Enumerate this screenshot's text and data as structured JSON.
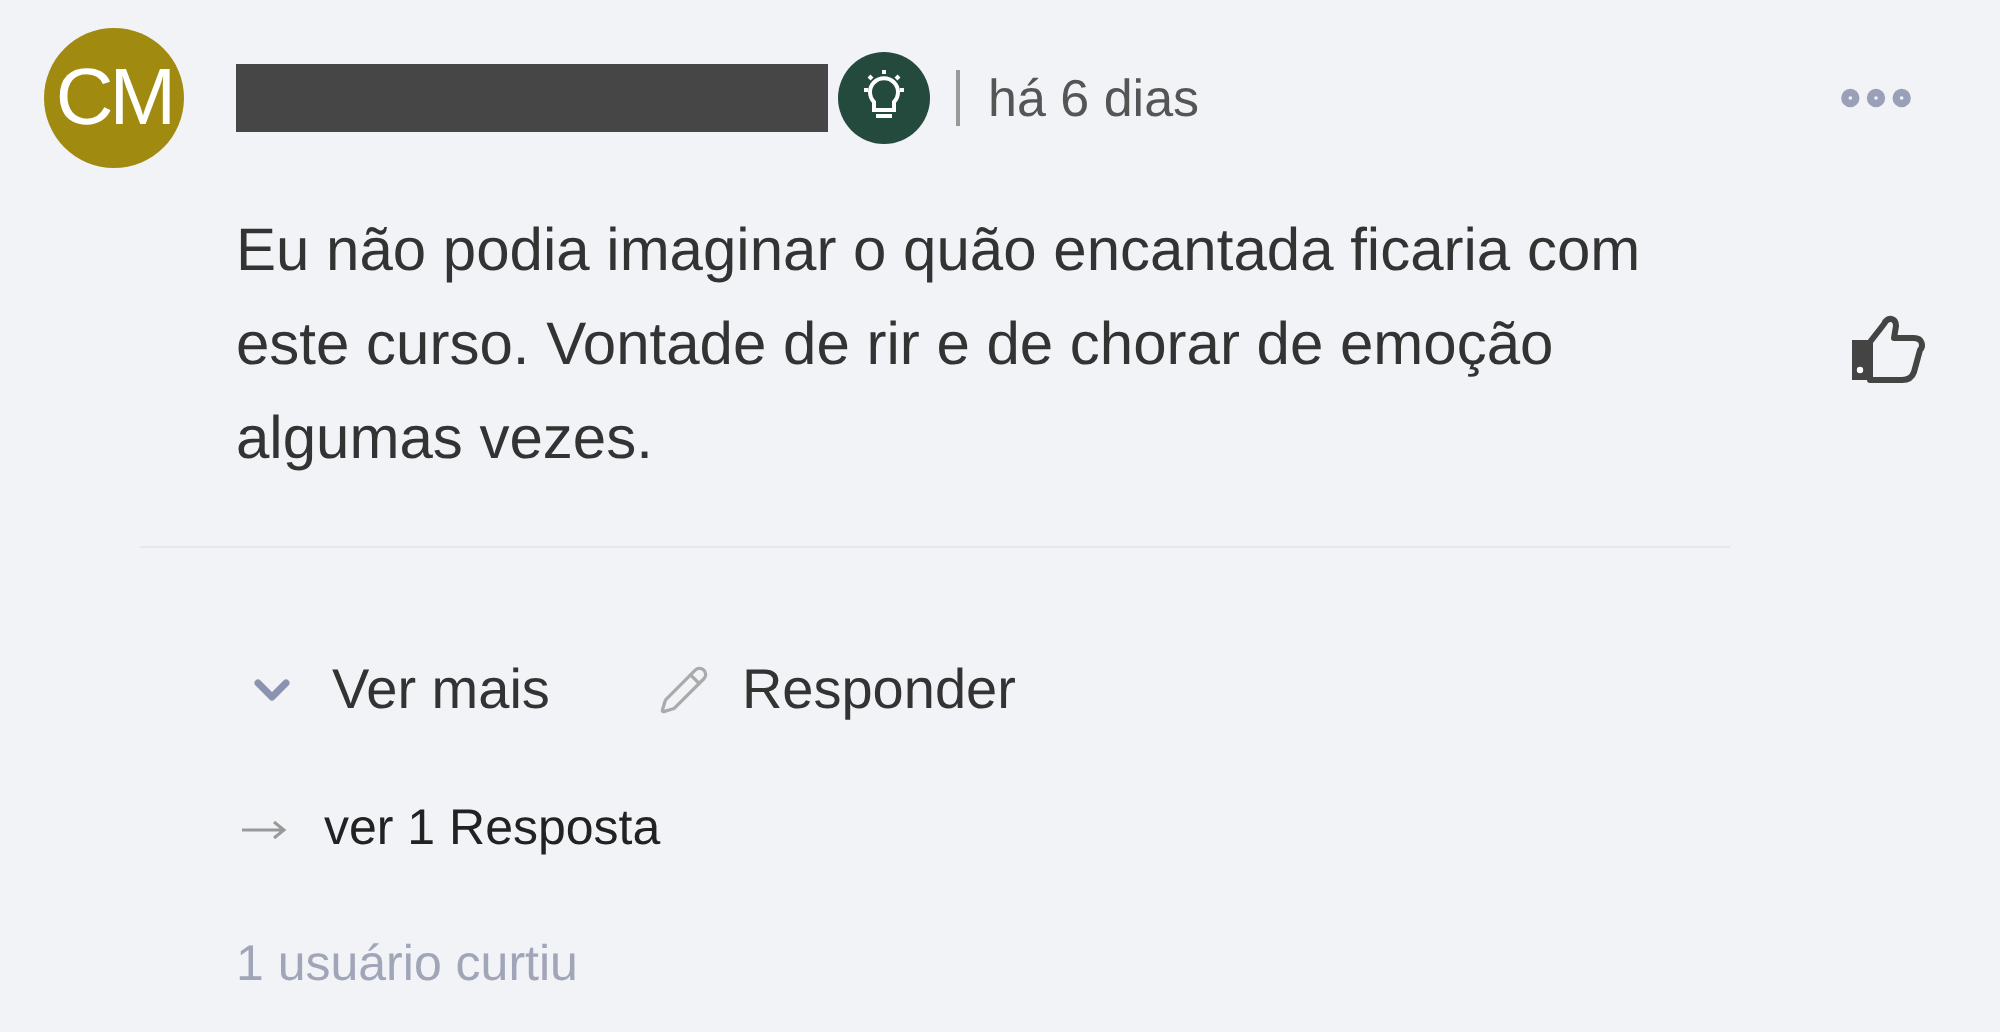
{
  "comment": {
    "avatar_initials": "CM",
    "author_redacted": true,
    "time": "há 6 dias",
    "text": "Eu não podia imaginar o quão encantada ficaria com este curso. Vontade de rir e de chorar de emoção algumas vezes.",
    "liked": false
  },
  "actions": [
    {
      "kind": "expand",
      "label": "Ver mais"
    },
    {
      "kind": "reply",
      "label": "Responder"
    }
  ],
  "replies_link": "ver 1 Resposta",
  "likes": "1 usuário curtiu"
}
